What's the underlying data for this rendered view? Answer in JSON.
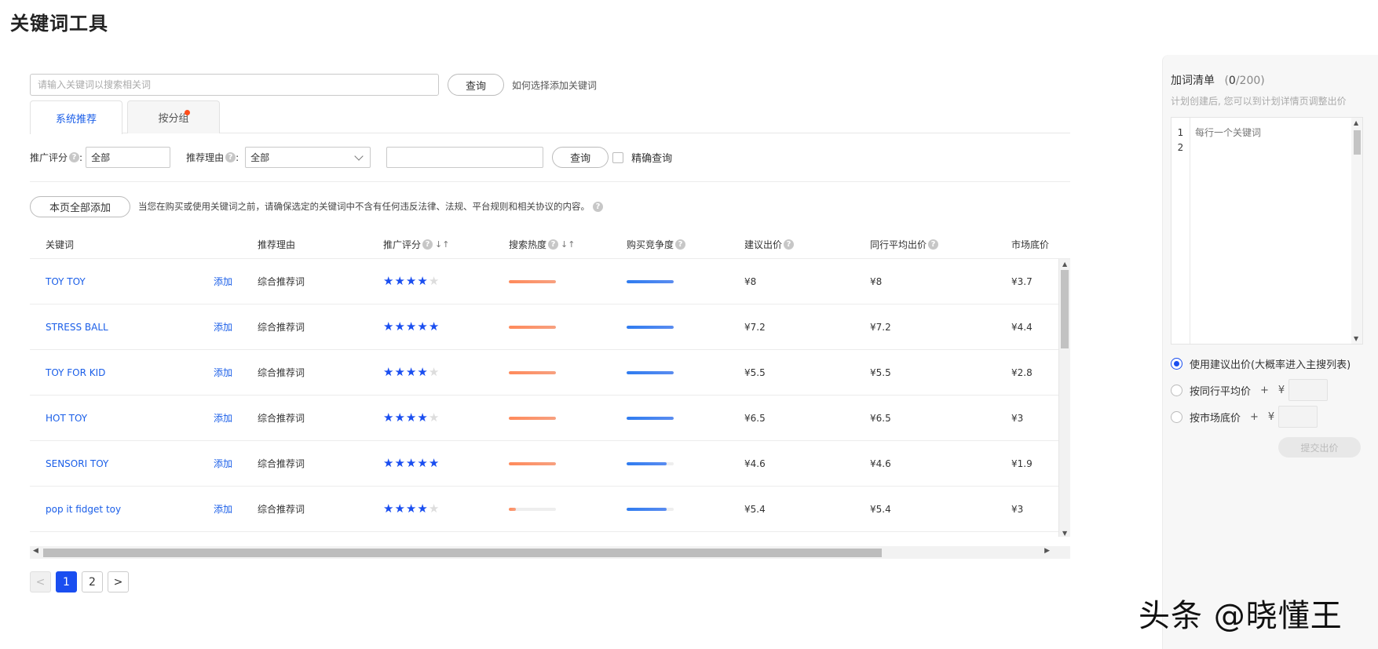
{
  "page_title": "关键词工具",
  "search": {
    "placeholder": "请输入关键词以搜索相关词",
    "query_button": "查询",
    "help_link": "如何选择添加关键词"
  },
  "tabs": [
    {
      "label": "系统推荐",
      "active": true
    },
    {
      "label": "按分组",
      "active": false,
      "has_dot": true
    }
  ],
  "filters": {
    "score_label": "推广评分",
    "score_value": "全部",
    "reason_label": "推荐理由",
    "reason_value": "全部",
    "query_button": "查询",
    "exact_label": "精确查询",
    "colon": ":"
  },
  "actions": {
    "add_all_button": "本页全部添加",
    "notice": "当您在购买或使用关键词之前，请确保选定的关键词中不含有任何违反法律、法规、平台规则和相关协议的内容。"
  },
  "table": {
    "columns": [
      "关键词",
      "推荐理由",
      "推广评分",
      "搜索热度",
      "购买竞争度",
      "建议出价",
      "同行平均出价",
      "市场底价"
    ],
    "add_label": "添加",
    "rows": [
      {
        "keyword": "TOY TOY",
        "reason": "综合推荐词",
        "stars": 4,
        "heat": 1.0,
        "competition": 1.0,
        "suggested": "¥8",
        "peer_avg": "¥8",
        "floor": "¥3.7"
      },
      {
        "keyword": "STRESS BALL",
        "reason": "综合推荐词",
        "stars": 5,
        "heat": 1.0,
        "competition": 1.0,
        "suggested": "¥7.2",
        "peer_avg": "¥7.2",
        "floor": "¥4.4"
      },
      {
        "keyword": "TOY FOR KID",
        "reason": "综合推荐词",
        "stars": 4,
        "heat": 1.0,
        "competition": 1.0,
        "suggested": "¥5.5",
        "peer_avg": "¥5.5",
        "floor": "¥2.8"
      },
      {
        "keyword": "HOT TOY",
        "reason": "综合推荐词",
        "stars": 4,
        "heat": 1.0,
        "competition": 1.0,
        "suggested": "¥6.5",
        "peer_avg": "¥6.5",
        "floor": "¥3"
      },
      {
        "keyword": "SENSORI TOY",
        "reason": "综合推荐词",
        "stars": 5,
        "heat": 1.0,
        "competition": 0.85,
        "suggested": "¥4.6",
        "peer_avg": "¥4.6",
        "floor": "¥1.9"
      },
      {
        "keyword": "pop it fidget toy",
        "reason": "综合推荐词",
        "stars": 4,
        "heat": 0.15,
        "competition": 0.85,
        "suggested": "¥5.4",
        "peer_avg": "¥5.4",
        "floor": "¥3"
      }
    ]
  },
  "pagination": {
    "prev": "<",
    "pages": [
      "1",
      "2"
    ],
    "current": "1",
    "next": ">"
  },
  "panel": {
    "title": "加词清单",
    "count_open": "(",
    "count_current": "0",
    "count_rest": "/200)",
    "hint": "计划创建后, 您可以到计划详情页调整出价",
    "line_numbers": [
      "1",
      "2"
    ],
    "editor_placeholder": "每行一个关键词",
    "options": [
      {
        "label": "使用建议出价(大概率进入主搜列表)",
        "selected": true
      },
      {
        "label": "按同行平均价",
        "selected": false,
        "plus": "+",
        "yen": "¥"
      },
      {
        "label": "按市场底价",
        "selected": false,
        "plus": "+",
        "yen": "¥"
      }
    ],
    "submit_button": "提交出价"
  },
  "watermark": "头条 @晓懂王",
  "colors": {
    "accent": "#1a4ef0",
    "link": "#1a5ee8",
    "heat_bar": "#ff8a5b",
    "competition_bar": "#2f7cf0",
    "dot": "#ff4d1a"
  }
}
